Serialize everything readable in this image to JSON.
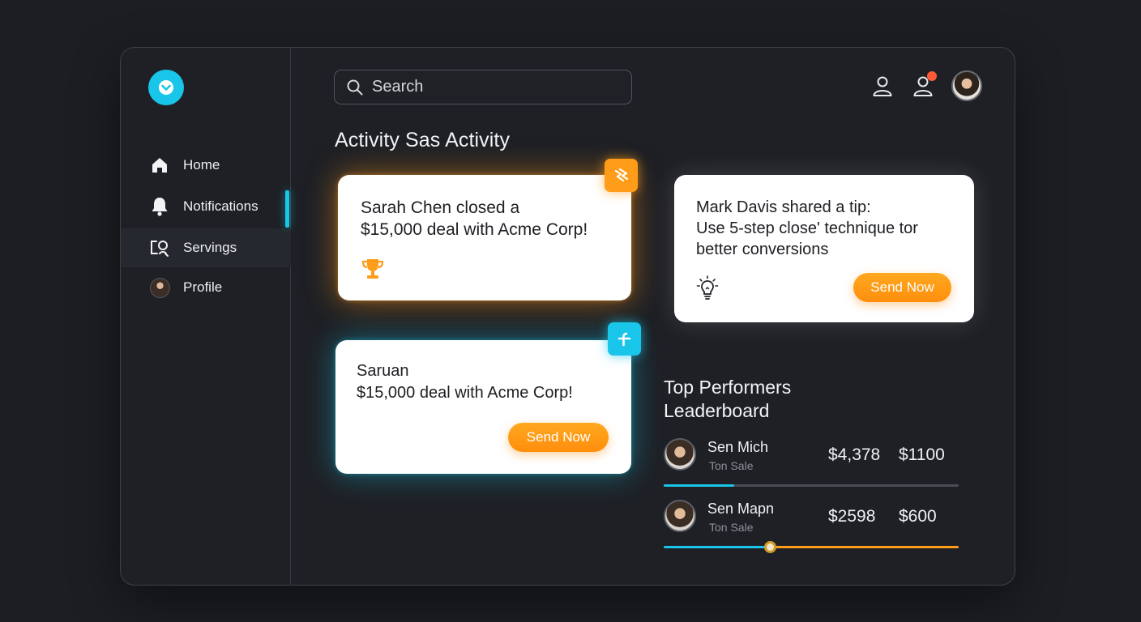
{
  "sidebar": {
    "items": [
      {
        "label": "Home",
        "icon": "home-icon"
      },
      {
        "label": "Notifications",
        "icon": "bell-icon",
        "active": true
      },
      {
        "label": "Servings",
        "icon": "settings-icon"
      },
      {
        "label": "Profile",
        "icon": "avatar"
      }
    ]
  },
  "search": {
    "placeholder": "Search"
  },
  "header": {
    "title": "Activity Sas Activity"
  },
  "cards": [
    {
      "line1": "Sarah Chen closed a",
      "line2": "$15,000 deal with Acme Corp!",
      "icon": "trophy-icon",
      "badge": "bolt-icon"
    },
    {
      "line1": "Mark Davis shared a tip:",
      "line2": "Use 5-step close' technique tor",
      "line3": "better conversions",
      "icon": "lightbulb-icon",
      "button": "Send Now"
    },
    {
      "line1": "Saruan",
      "line2": "$15,000 deal with Acme Corp!",
      "badge": "plus-icon",
      "button": "Send Now"
    }
  ],
  "leaderboard": {
    "title": "Top Performers Leaderboard",
    "rows": [
      {
        "name": "Sen Mich",
        "sub": "Ton Sale",
        "value1": "$4,378",
        "value2": "$1100",
        "progress": 0.24
      },
      {
        "name": "Sen Mapn",
        "sub": "Ton Sale",
        "value1": "$2598",
        "value2": "$600",
        "progress": 0.36
      }
    ]
  },
  "colors": {
    "accent_cyan": "#19c5e8",
    "accent_orange": "#ff9c1a",
    "notification_dot": "#ff5a36"
  }
}
